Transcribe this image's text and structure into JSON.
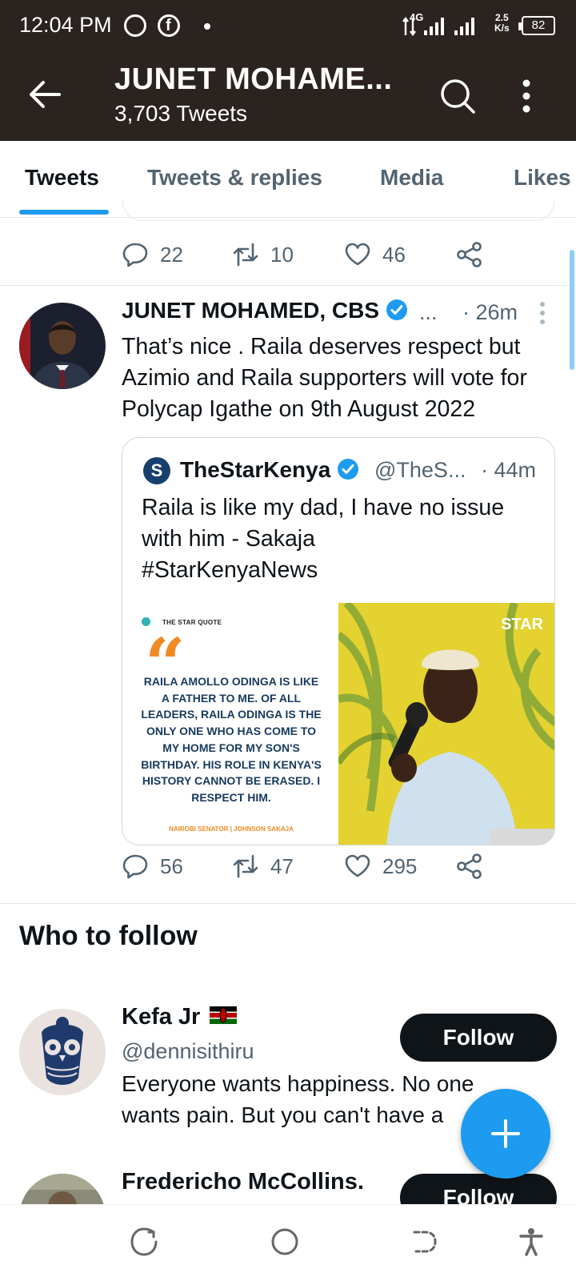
{
  "status_bar": {
    "time": "12:04 PM",
    "network": "4G",
    "speed_top": "2.5",
    "speed_bottom": "K/s",
    "battery": "82"
  },
  "header": {
    "title": "JUNET MOHAME...",
    "subtitle": "3,703 Tweets"
  },
  "tabs": [
    {
      "label": "Tweets",
      "active": true
    },
    {
      "label": "Tweets & replies",
      "active": false
    },
    {
      "label": "Media",
      "active": false
    },
    {
      "label": "Likes",
      "active": false
    }
  ],
  "previous_tweet": {
    "replies": "22",
    "retweets": "10",
    "likes": "46"
  },
  "tweet": {
    "author": "JUNET MOHAMED, CBS",
    "ellipsis": "...",
    "time": "· 26m",
    "text": "That’s nice . Raila deserves respect but Azimio and Raila supporters will vote for Polycap Igathe on 9th August 2022",
    "replies": "56",
    "retweets": "47",
    "likes": "295",
    "quote": {
      "author": "TheStarKenya",
      "handle": "@TheS...",
      "time": "· 44m",
      "text_line1": "Raila is like my dad, I have no issue",
      "text_line2": "with him - Sakaja",
      "text_line3": "#StarKenyaNews",
      "image": {
        "label": "THE STAR QUOTE",
        "quote_text": "RAILA AMOLLO ODINGA IS LIKE A FATHER TO ME. OF ALL LEADERS, RAILA ODINGA IS THE ONLY ONE WHO HAS COME TO MY HOME FOR MY SON'S BIRTHDAY. HIS ROLE IN KENYA'S HISTORY CANNOT BE ERASED. I RESPECT HIM.",
        "credit": "NAIROBI SENATOR | JOHNSON SAKAJA",
        "brand": "STAR"
      }
    }
  },
  "who_to_follow": {
    "title": "Who to follow",
    "users": [
      {
        "name": "Kefa Jr",
        "handle": "@dennisithiru",
        "bio_line1": "Everyone wants happiness. No one",
        "bio_line2": "wants pain. But you can't have a",
        "button": "Follow"
      },
      {
        "name": "Fredericho McCollins.",
        "button": "Follow"
      }
    ]
  },
  "colors": {
    "header_bg": "#2a2320",
    "accent": "#1d9bf0",
    "text_secondary": "#536471"
  }
}
